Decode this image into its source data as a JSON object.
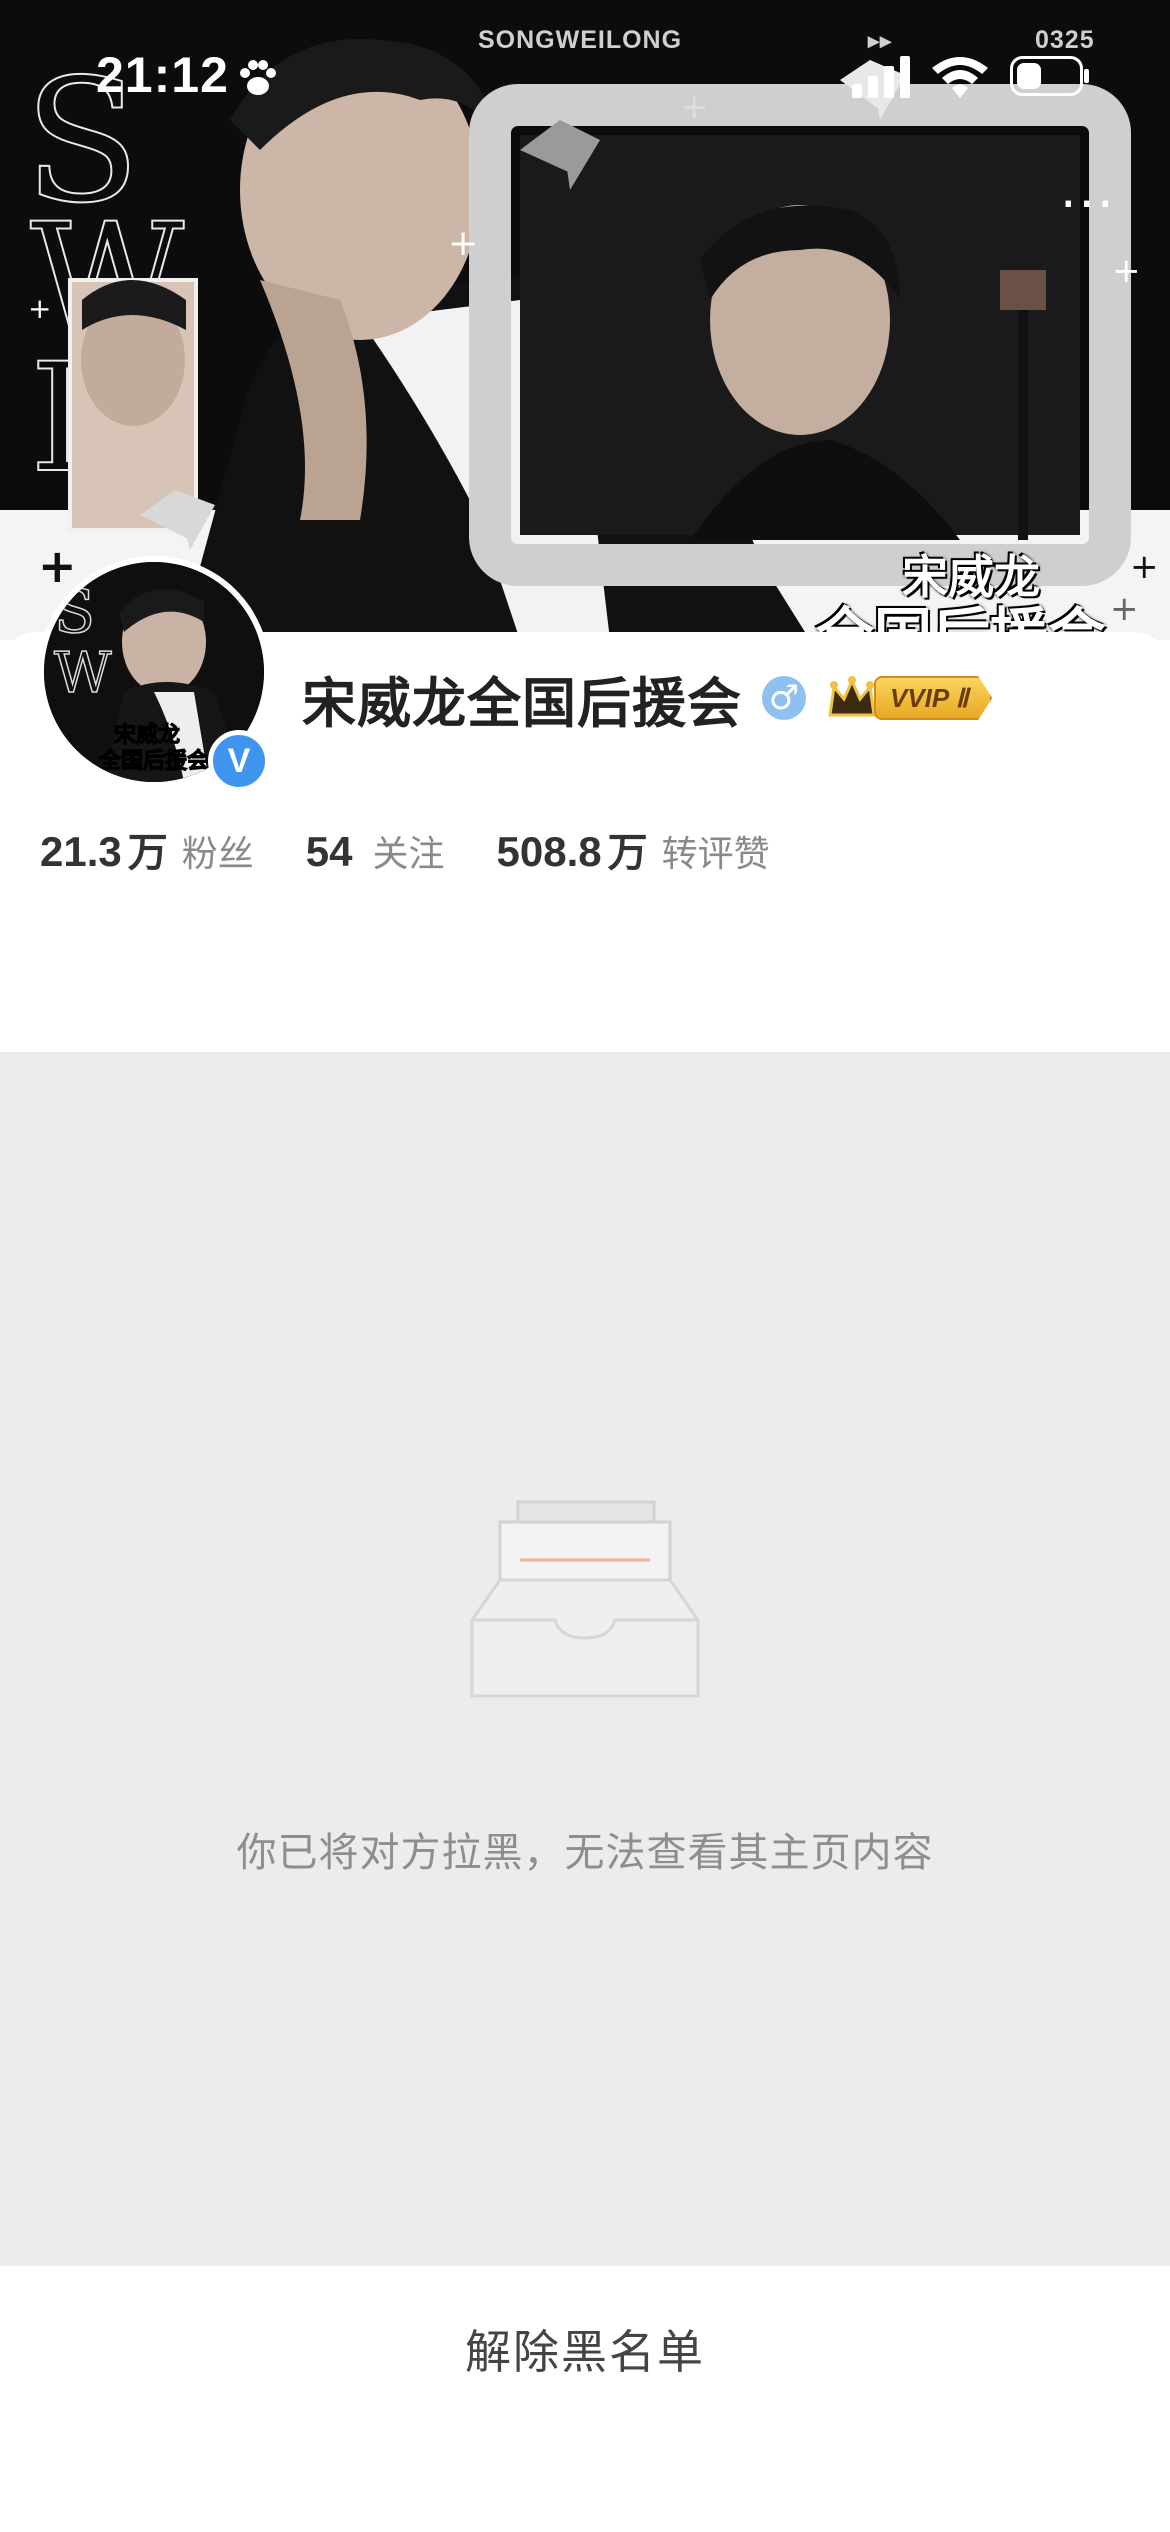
{
  "status_bar": {
    "time": "21:12",
    "banner_name": "SONGWEILONG",
    "banner_code": "0325"
  },
  "banner": {
    "caption_line1": "宋威龙",
    "caption_line2": "全国后援会",
    "more_icon": "more-dots-icon"
  },
  "profile": {
    "name": "宋威龙全国后援会",
    "gender_symbol": "♂",
    "vip_label": "VVIP Ⅱ",
    "verified_symbol": "V"
  },
  "stats": [
    {
      "value": "21.3",
      "unit": "万",
      "label": "粉丝"
    },
    {
      "value": "54",
      "unit": "",
      "label": "关注"
    },
    {
      "value": "508.8",
      "unit": "万",
      "label": "转评赞"
    }
  ],
  "blocked": {
    "message": "你已将对方拉黑，无法查看其主页内容"
  },
  "bottom": {
    "unblock_label": "解除黑名单"
  },
  "colors": {
    "verified_blue": "#3f95ee",
    "gender_blue": "#8ec1ef",
    "vip_gold": "#f2c143",
    "blocked_bg": "#ececec",
    "inbox_stripe": "#f2b093"
  }
}
